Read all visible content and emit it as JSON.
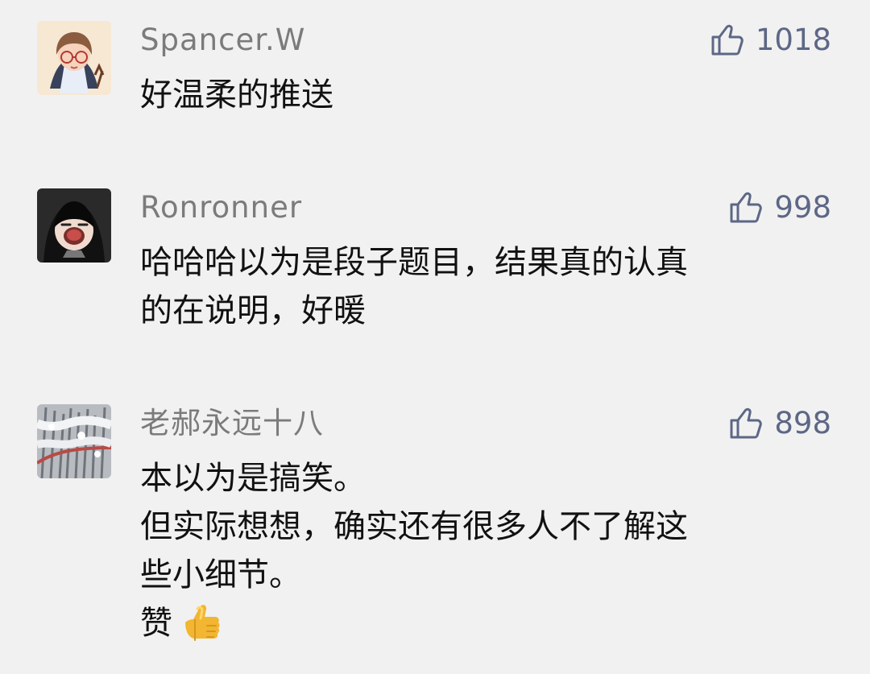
{
  "comments": [
    {
      "nickname": "Spancer.W",
      "likes": "1018",
      "content": [
        "好温柔的推送"
      ],
      "avatar_icon": "girl-with-glasses-avatar"
    },
    {
      "nickname": "Ronronner",
      "likes": "998",
      "content": [
        "哈哈哈以为是段子题目，结果真的认真",
        "的在说明，好暖"
      ],
      "avatar_icon": "laughing-dark-hair-avatar"
    },
    {
      "nickname": "老郝永远十八",
      "likes": "898",
      "content": [
        "本以为是搞笑。",
        "但实际想想，确实还有很多人不了解这",
        "些小细节。",
        "赞"
      ],
      "avatar_icon": "snowy-forest-avatar",
      "emoji": "thumbs-up-emoji"
    }
  ],
  "colors": {
    "background": "#f1f1f1",
    "nickname": "#7b7b7b",
    "like": "#5d6786",
    "content": "#111111"
  }
}
